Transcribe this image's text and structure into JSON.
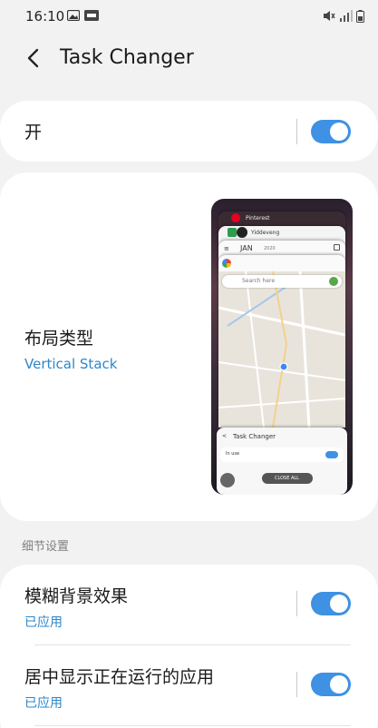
{
  "status_bar": {
    "time": "16:10"
  },
  "header": {
    "title": "Task Changer"
  },
  "main_toggle": {
    "label": "开",
    "on": true
  },
  "layout": {
    "label": "布局类型",
    "value": "Vertical Stack",
    "preview": {
      "apps": [
        "Pinterest",
        "Yiddeveng",
        "JAN",
        "2020"
      ],
      "search_placeholder": "Search here",
      "task_changer_title": "Task Changer",
      "in_use": "In use",
      "close_all": "CLOSE ALL"
    }
  },
  "section_title": "细节设置",
  "details": [
    {
      "label": "模糊背景效果",
      "sub": "已应用",
      "on": true
    },
    {
      "label": "居中显示正在运行的应用",
      "sub": "已应用",
      "on": true
    }
  ],
  "colors": {
    "accent": "#3e91e3",
    "link": "#2e86c8",
    "background": "#f2f2f2"
  }
}
